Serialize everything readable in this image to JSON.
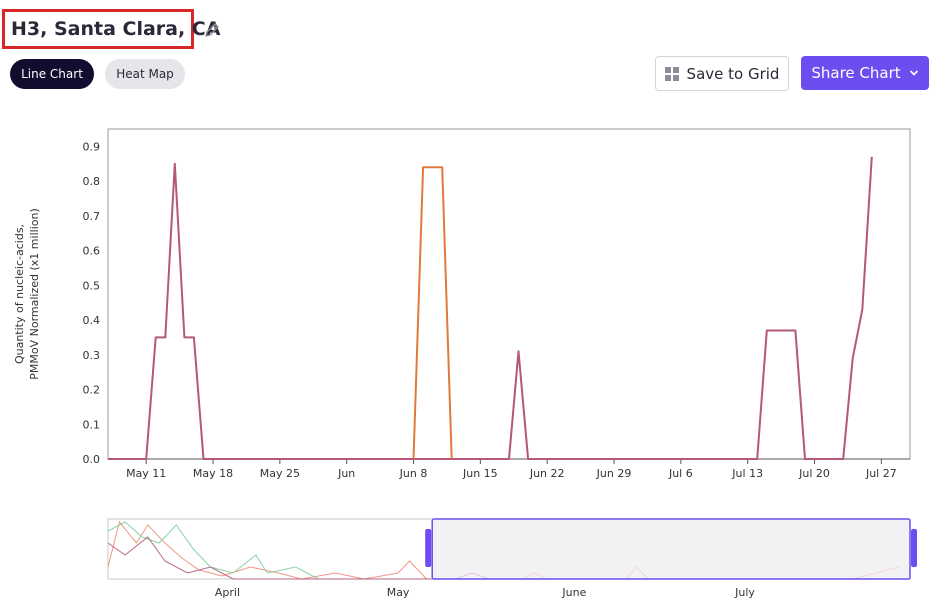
{
  "header": {
    "title": "H3, Santa Clara, CA",
    "edit_icon": "pencil-icon"
  },
  "view_tabs": [
    {
      "label": "Line Chart",
      "active": true
    },
    {
      "label": "Heat Map",
      "active": false
    }
  ],
  "toolbar": {
    "save_label": "Save to Grid",
    "save_icon": "grid-icon",
    "share_label": "Share Chart",
    "share_icon": "chevron-down-icon"
  },
  "colors": {
    "accent": "#6e4df0",
    "series_primary": "#b5577d",
    "series_secondary": "#e07a3c",
    "title_highlight": "#d62828"
  },
  "chart_data": [
    {
      "type": "line",
      "ylabel_line1": "Quantity of nucleic-acids,",
      "ylabel_line2": "PMMoV Normalized (x1 million)",
      "ylim": [
        0,
        0.95
      ],
      "yticks": [
        "0.0",
        "0.1",
        "0.2",
        "0.3",
        "0.4",
        "0.5",
        "0.6",
        "0.7",
        "0.8",
        "0.9"
      ],
      "xlim": [
        "2025-05-07",
        "2025-07-30"
      ],
      "xticks": [
        {
          "date": "2025-05-11",
          "label": "May 11"
        },
        {
          "date": "2025-05-18",
          "label": "May 18"
        },
        {
          "date": "2025-05-25",
          "label": "May 25"
        },
        {
          "date": "2025-06-01",
          "label": "Jun"
        },
        {
          "date": "2025-06-08",
          "label": "Jun 8"
        },
        {
          "date": "2025-06-15",
          "label": "Jun 15"
        },
        {
          "date": "2025-06-22",
          "label": "Jun 22"
        },
        {
          "date": "2025-06-29",
          "label": "Jun 29"
        },
        {
          "date": "2025-07-06",
          "label": "Jul 6"
        },
        {
          "date": "2025-07-13",
          "label": "Jul 13"
        },
        {
          "date": "2025-07-20",
          "label": "Jul 20"
        },
        {
          "date": "2025-07-27",
          "label": "Jul 27"
        }
      ],
      "grid": false,
      "series": [
        {
          "color": "#b5577d",
          "points": [
            [
              "2025-05-07",
              0
            ],
            [
              "2025-05-11",
              0
            ],
            [
              "2025-05-12",
              0.35
            ],
            [
              "2025-05-13",
              0.35
            ],
            [
              "2025-05-14",
              0.85
            ],
            [
              "2025-05-15",
              0.35
            ],
            [
              "2025-05-16",
              0.35
            ],
            [
              "2025-05-17",
              0
            ],
            [
              "2025-06-18",
              0
            ],
            [
              "2025-06-19",
              0.31
            ],
            [
              "2025-06-20",
              0
            ],
            [
              "2025-07-14",
              0
            ],
            [
              "2025-07-15",
              0.37
            ],
            [
              "2025-07-18",
              0.37
            ],
            [
              "2025-07-19",
              0
            ],
            [
              "2025-07-23",
              0
            ],
            [
              "2025-07-24",
              0.29
            ],
            [
              "2025-07-25",
              0.43
            ],
            [
              "2025-07-26",
              0.87
            ]
          ]
        },
        {
          "color": "#e07a3c",
          "points": [
            [
              "2025-06-08",
              0
            ],
            [
              "2025-06-09",
              0.84
            ],
            [
              "2025-06-11",
              0.84
            ],
            [
              "2025-06-12",
              0
            ]
          ]
        }
      ]
    },
    {
      "type": "area",
      "xticks": [
        {
          "date": "2025-04-01",
          "label": "April"
        },
        {
          "date": "2025-05-01",
          "label": "May"
        },
        {
          "date": "2025-06-01",
          "label": "June"
        },
        {
          "date": "2025-07-01",
          "label": "July"
        }
      ],
      "xlim": [
        "2025-03-11",
        "2025-07-30"
      ],
      "selected_range": [
        "2025-05-07",
        "2025-07-30"
      ],
      "series": [
        {
          "color": "#f08c7a",
          "points": [
            [
              "2025-03-11",
              0.2
            ],
            [
              "2025-03-13",
              0.95
            ],
            [
              "2025-03-16",
              0.6
            ],
            [
              "2025-03-18",
              0.9
            ],
            [
              "2025-03-21",
              0.6
            ],
            [
              "2025-03-24",
              0.35
            ],
            [
              "2025-03-27",
              0.15
            ],
            [
              "2025-03-31",
              0.05
            ],
            [
              "2025-04-05",
              0.2
            ],
            [
              "2025-04-10",
              0.1
            ],
            [
              "2025-04-14",
              0
            ],
            [
              "2025-04-20",
              0.1
            ],
            [
              "2025-04-25",
              0
            ],
            [
              "2025-05-01",
              0.1
            ],
            [
              "2025-05-03",
              0.3
            ],
            [
              "2025-05-06",
              0
            ],
            [
              "2025-05-23",
              0
            ],
            [
              "2025-05-25",
              0.1
            ],
            [
              "2025-05-27",
              0
            ],
            [
              "2025-06-10",
              0
            ],
            [
              "2025-06-12",
              0.2
            ],
            [
              "2025-06-14",
              0
            ],
            [
              "2025-07-20",
              0
            ],
            [
              "2025-07-28",
              0.2
            ]
          ]
        },
        {
          "color": "#7ccf9c",
          "points": [
            [
              "2025-03-11",
              0.8
            ],
            [
              "2025-03-14",
              0.95
            ],
            [
              "2025-03-17",
              0.7
            ],
            [
              "2025-03-20",
              0.6
            ],
            [
              "2025-03-23",
              0.9
            ],
            [
              "2025-03-26",
              0.5
            ],
            [
              "2025-03-29",
              0.2
            ],
            [
              "2025-04-02",
              0.1
            ],
            [
              "2025-04-06",
              0.4
            ],
            [
              "2025-04-08",
              0.1
            ],
            [
              "2025-04-13",
              0.2
            ],
            [
              "2025-04-17",
              0
            ],
            [
              "2025-05-01",
              0
            ]
          ]
        },
        {
          "color": "#b5577d",
          "points": [
            [
              "2025-03-11",
              0.6
            ],
            [
              "2025-03-14",
              0.4
            ],
            [
              "2025-03-18",
              0.7
            ],
            [
              "2025-03-21",
              0.3
            ],
            [
              "2025-03-25",
              0.1
            ],
            [
              "2025-03-29",
              0.2
            ],
            [
              "2025-04-02",
              0
            ],
            [
              "2025-05-07",
              0
            ],
            [
              "2025-05-11",
              0
            ],
            [
              "2025-05-14",
              0.1
            ],
            [
              "2025-05-17",
              0
            ],
            [
              "2025-07-30",
              0
            ]
          ]
        }
      ]
    }
  ]
}
